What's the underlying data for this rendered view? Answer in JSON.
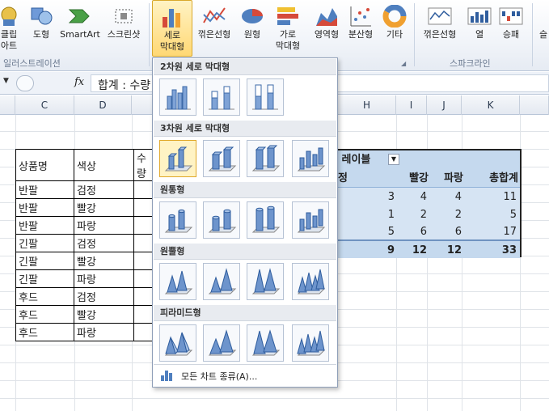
{
  "ribbon": {
    "buttons": {
      "clipart": "클립\n아트",
      "shapes": "도형",
      "smartart": "SmartArt",
      "screenshot": "스크린샷",
      "column": "세로\n막대형",
      "line": "꺾은선형",
      "pie": "원형",
      "bar": "가로\n막대형",
      "area": "영역형",
      "scatter": "분산형",
      "other": "기타",
      "spark_line": "꺾은선형",
      "spark_column": "열",
      "spark_winloss": "승패",
      "cutoff": "슬"
    },
    "groups": {
      "illustrations": "일러스트레이션",
      "sparklines": "스파크라인"
    },
    "colors": {
      "accent": "#ffd874",
      "ribbon_bg": "#eef2f8"
    }
  },
  "formula_bar": {
    "fx": "fx",
    "value": "합계 : 수량"
  },
  "columns": [
    "C",
    "D",
    "H",
    "I",
    "J",
    "K"
  ],
  "table": {
    "headers": [
      "상품명",
      "색상",
      "수량"
    ],
    "rows": [
      [
        "반팔",
        "검정"
      ],
      [
        "반팔",
        "빨강"
      ],
      [
        "반팔",
        "파랑"
      ],
      [
        "긴팔",
        "검정"
      ],
      [
        "긴팔",
        "빨강"
      ],
      [
        "긴팔",
        "파랑"
      ],
      [
        "후드",
        "검정"
      ],
      [
        "후드",
        "빨강"
      ],
      [
        "후드",
        "파랑"
      ]
    ]
  },
  "pivot": {
    "col_label_header": "열 레이블",
    "headers": [
      "검정",
      "빨강",
      "파랑",
      "총합계"
    ],
    "rows": [
      [
        "3",
        "4",
        "4",
        "11"
      ],
      [
        "1",
        "2",
        "2",
        "5"
      ],
      [
        "5",
        "6",
        "6",
        "17"
      ]
    ],
    "totals": [
      "9",
      "12",
      "12",
      "33"
    ]
  },
  "gallery": {
    "sections": [
      "2차원 세로 막대형",
      "3차원 세로 막대형",
      "원통형",
      "원뿔형",
      "피라미드형"
    ],
    "more_label": "모든 차트 종류(A)..."
  }
}
